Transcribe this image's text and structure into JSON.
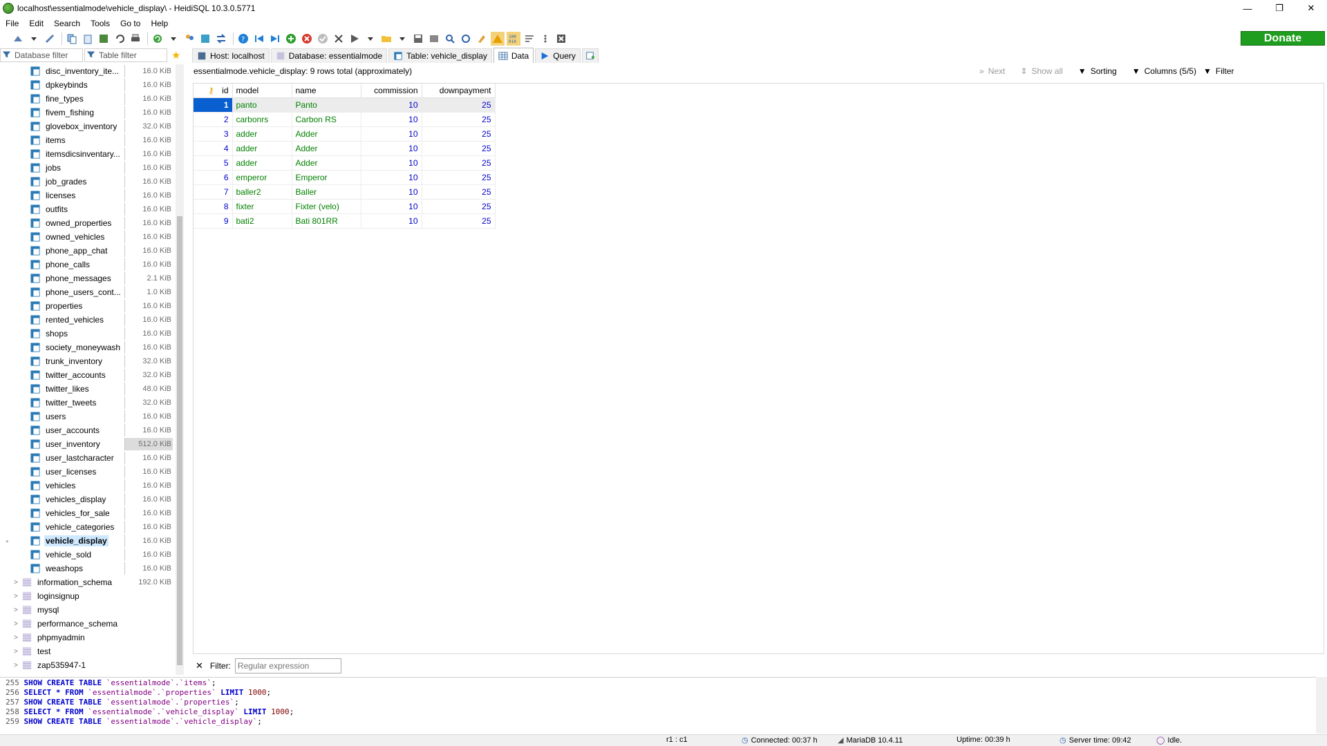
{
  "window": {
    "title": "localhost\\essentialmode\\vehicle_display\\ - HeidiSQL 10.3.0.5771",
    "controls": [
      "—",
      "❐",
      "✕"
    ]
  },
  "menu": [
    "File",
    "Edit",
    "Search",
    "Tools",
    "Go to",
    "Help"
  ],
  "toolbar": {
    "donate_label": "Donate"
  },
  "filters": {
    "database_filter_placeholder": "Database filter",
    "table_filter_placeholder": "Table filter"
  },
  "tabs": [
    {
      "label": "Host: localhost"
    },
    {
      "label": "Database: essentialmode"
    },
    {
      "label": "Table: vehicle_display"
    },
    {
      "label": "Data"
    },
    {
      "label": "Query"
    }
  ],
  "tree": {
    "tables": [
      {
        "name": "disc_inventory_ite...",
        "size": "16.0 KiB"
      },
      {
        "name": "dpkeybinds",
        "size": "16.0 KiB"
      },
      {
        "name": "fine_types",
        "size": "16.0 KiB"
      },
      {
        "name": "fivem_fishing",
        "size": "16.0 KiB"
      },
      {
        "name": "glovebox_inventory",
        "size": "32.0 KiB"
      },
      {
        "name": "items",
        "size": "16.0 KiB"
      },
      {
        "name": "itemsdicsinventary...",
        "size": "16.0 KiB"
      },
      {
        "name": "jobs",
        "size": "16.0 KiB"
      },
      {
        "name": "job_grades",
        "size": "16.0 KiB"
      },
      {
        "name": "licenses",
        "size": "16.0 KiB"
      },
      {
        "name": "outfits",
        "size": "16.0 KiB"
      },
      {
        "name": "owned_properties",
        "size": "16.0 KiB"
      },
      {
        "name": "owned_vehicles",
        "size": "16.0 KiB"
      },
      {
        "name": "phone_app_chat",
        "size": "16.0 KiB"
      },
      {
        "name": "phone_calls",
        "size": "16.0 KiB"
      },
      {
        "name": "phone_messages",
        "size": "2.1 KiB"
      },
      {
        "name": "phone_users_cont...",
        "size": "1.0 KiB"
      },
      {
        "name": "properties",
        "size": "16.0 KiB"
      },
      {
        "name": "rented_vehicles",
        "size": "16.0 KiB"
      },
      {
        "name": "shops",
        "size": "16.0 KiB"
      },
      {
        "name": "society_moneywash",
        "size": "16.0 KiB"
      },
      {
        "name": "trunk_inventory",
        "size": "32.0 KiB"
      },
      {
        "name": "twitter_accounts",
        "size": "32.0 KiB"
      },
      {
        "name": "twitter_likes",
        "size": "48.0 KiB"
      },
      {
        "name": "twitter_tweets",
        "size": "32.0 KiB"
      },
      {
        "name": "users",
        "size": "16.0 KiB"
      },
      {
        "name": "user_accounts",
        "size": "16.0 KiB"
      },
      {
        "name": "user_inventory",
        "size": "512.0 KiB"
      },
      {
        "name": "user_lastcharacter",
        "size": "16.0 KiB"
      },
      {
        "name": "user_licenses",
        "size": "16.0 KiB"
      },
      {
        "name": "vehicles",
        "size": "16.0 KiB"
      },
      {
        "name": "vehicles_display",
        "size": "16.0 KiB"
      },
      {
        "name": "vehicles_for_sale",
        "size": "16.0 KiB"
      },
      {
        "name": "vehicle_categories",
        "size": "16.0 KiB"
      },
      {
        "name": "vehicle_display",
        "size": "16.0 KiB",
        "selected": true
      },
      {
        "name": "vehicle_sold",
        "size": "16.0 KiB"
      },
      {
        "name": "weashops",
        "size": "16.0 KiB"
      }
    ],
    "databases": [
      {
        "name": "information_schema",
        "size": "192.0 KiB"
      },
      {
        "name": "loginsignup",
        "size": ""
      },
      {
        "name": "mysql",
        "size": ""
      },
      {
        "name": "performance_schema",
        "size": ""
      },
      {
        "name": "phpmyadmin",
        "size": ""
      },
      {
        "name": "test",
        "size": ""
      },
      {
        "name": "zap535947-1",
        "size": ""
      }
    ]
  },
  "data_view": {
    "info": "essentialmode.vehicle_display: 9 rows total (approximately)",
    "next_label": "Next",
    "show_all_label": "Show all",
    "sorting_label": "Sorting",
    "columns_label": "Columns (5/5)",
    "filter_label": "Filter"
  },
  "grid": {
    "columns": [
      "id",
      "model",
      "name",
      "commission",
      "downpayment"
    ],
    "rows": [
      [
        "1",
        "panto",
        "Panto",
        "10",
        "25"
      ],
      [
        "2",
        "carbonrs",
        "Carbon RS",
        "10",
        "25"
      ],
      [
        "3",
        "adder",
        "Adder",
        "10",
        "25"
      ],
      [
        "4",
        "adder",
        "Adder",
        "10",
        "25"
      ],
      [
        "5",
        "adder",
        "Adder",
        "10",
        "25"
      ],
      [
        "6",
        "emperor",
        "Emperor",
        "10",
        "25"
      ],
      [
        "7",
        "baller2",
        "Baller",
        "10",
        "25"
      ],
      [
        "8",
        "fixter",
        "Fixter (velo)",
        "10",
        "25"
      ],
      [
        "9",
        "bati2",
        "Bati 801RR",
        "10",
        "25"
      ]
    ]
  },
  "filter_row": {
    "close_label": "✕",
    "label": "Filter:",
    "placeholder": "Regular expression"
  },
  "sql_log": [
    {
      "n": "255",
      "parts": [
        [
          "kw",
          "SHOW CREATE TABLE "
        ],
        [
          "idf",
          "`essentialmode`.`items`"
        ],
        [
          "plain",
          ";"
        ]
      ]
    },
    {
      "n": "256",
      "parts": [
        [
          "kw",
          "SELECT * FROM "
        ],
        [
          "idf",
          "`essentialmode`.`properties`"
        ],
        [
          "kw",
          " LIMIT "
        ],
        [
          "nm",
          "1000"
        ],
        [
          "plain",
          ";"
        ]
      ]
    },
    {
      "n": "257",
      "parts": [
        [
          "kw",
          "SHOW CREATE TABLE "
        ],
        [
          "idf",
          "`essentialmode`.`properties`"
        ],
        [
          "plain",
          ";"
        ]
      ]
    },
    {
      "n": "258",
      "parts": [
        [
          "kw",
          "SELECT * FROM "
        ],
        [
          "idf",
          "`essentialmode`.`vehicle_display`"
        ],
        [
          "kw",
          " LIMIT "
        ],
        [
          "nm",
          "1000"
        ],
        [
          "plain",
          ";"
        ]
      ]
    },
    {
      "n": "259",
      "parts": [
        [
          "kw",
          "SHOW CREATE TABLE "
        ],
        [
          "idf",
          "`essentialmode`.`vehicle_display`"
        ],
        [
          "plain",
          ";"
        ]
      ]
    }
  ],
  "status": {
    "cursor": "r1 : c1",
    "connected": "Connected: 00:37 h",
    "server": "MariaDB 10.4.11",
    "uptime": "Uptime: 00:39 h",
    "server_time": "Server time: 09:42",
    "state": "Idle."
  },
  "colors": {
    "accent": "#0a5fd0",
    "donate": "#1f9d1f",
    "numbers": "#0000cc",
    "strings": "#008000"
  }
}
